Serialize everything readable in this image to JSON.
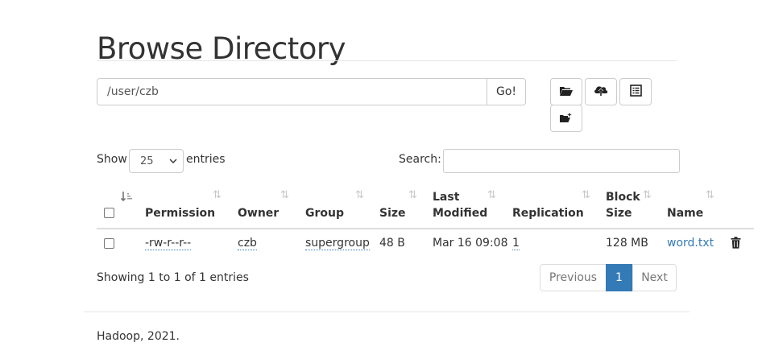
{
  "page_title": "Browse Directory",
  "toolbar": {
    "path_value": "/user/czb",
    "go_label": "Go!",
    "icons": [
      "open-folder-icon",
      "cloud-upload-icon",
      "list-icon",
      "cut-paste-icon"
    ]
  },
  "table_controls": {
    "show_label": "Show",
    "entries_value": "25",
    "entries_label": "entries",
    "search_label": "Search:",
    "search_value": ""
  },
  "table": {
    "headers": {
      "permission": "Permission",
      "owner": "Owner",
      "group": "Group",
      "size": "Size",
      "last_modified_1": "Last",
      "last_modified_2": "Modified",
      "replication": "Replication",
      "block_size_1": "Block",
      "block_size_2": "Size",
      "name": "Name"
    },
    "rows": [
      {
        "permission": "-rw-r--r--",
        "owner": "czb",
        "group": "supergroup",
        "size": "48 B",
        "last_modified": "Mar 16 09:08",
        "replication": "1",
        "block_size": "128 MB",
        "name": "word.txt"
      }
    ]
  },
  "pagination": {
    "info": "Showing 1 to 1 of 1 entries",
    "previous": "Previous",
    "current": "1",
    "next": "Next"
  },
  "footer": "Hadoop, 2021.",
  "colors": {
    "accent": "#337ab7",
    "border": "#cccccc"
  }
}
